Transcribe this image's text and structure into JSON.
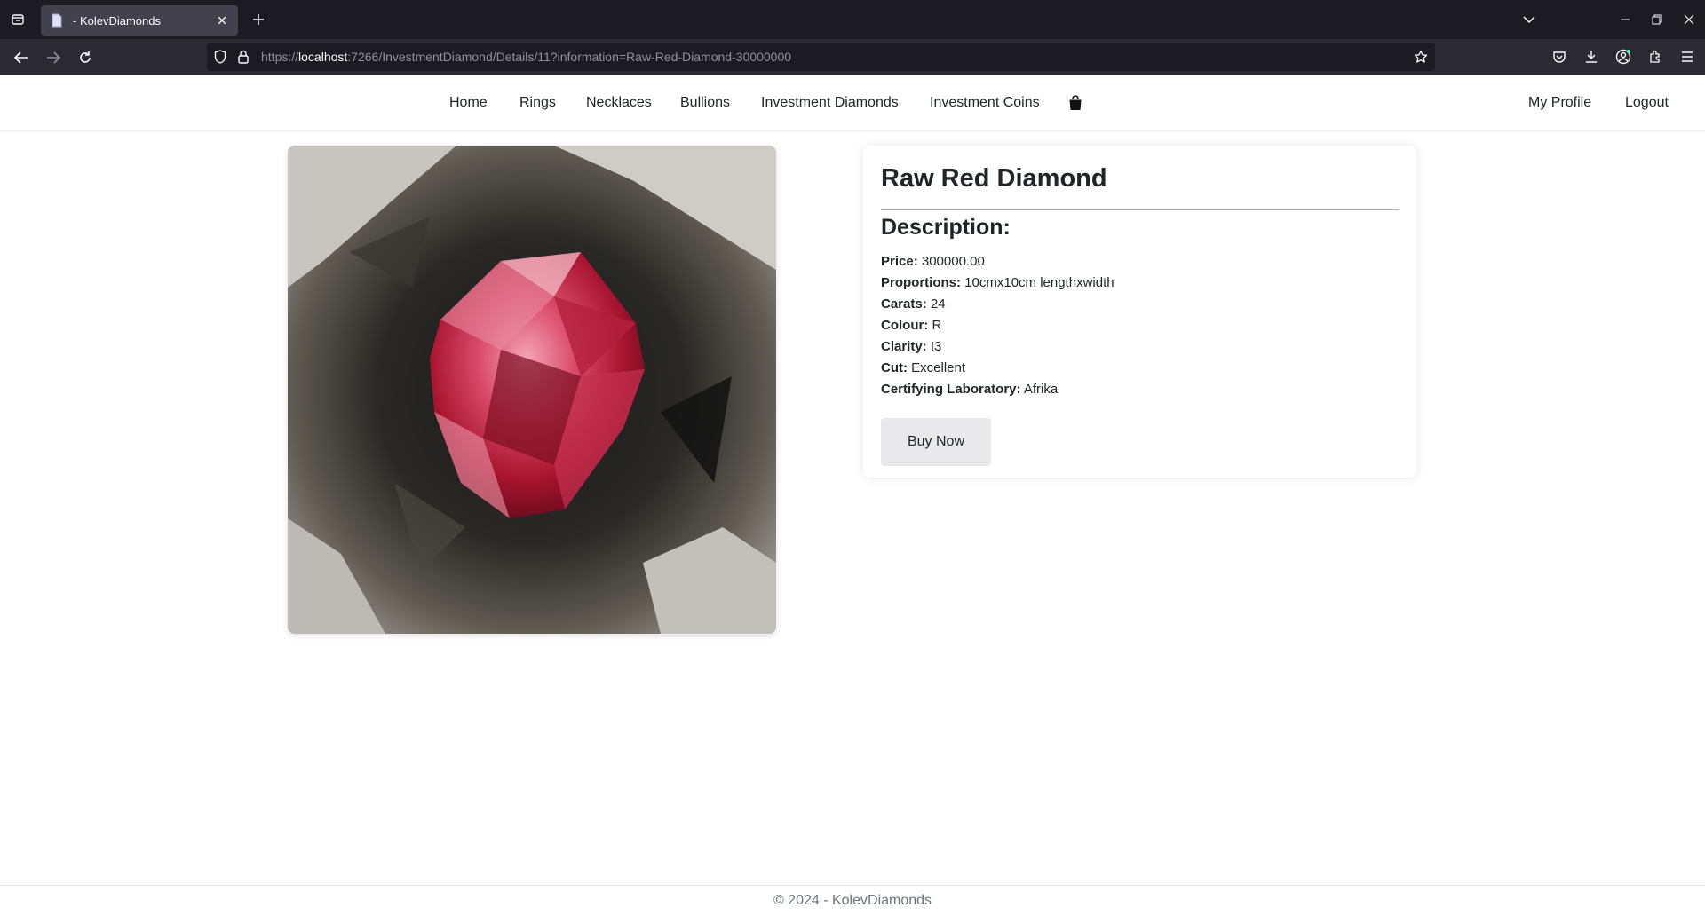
{
  "browser": {
    "tab_title": "- KolevDiamonds",
    "url_prefix": "https://",
    "url_host": "localhost",
    "url_rest": ":7266/InvestmentDiamond/Details/11?information=Raw-Red-Diamond-30000000",
    "icons": [
      "tab-list-icon",
      "page-favicon-icon",
      "close-icon",
      "plus-icon",
      "chevron-down-icon",
      "minimize-icon",
      "restore-icon",
      "close-window-icon",
      "back-arrow-icon",
      "forward-arrow-icon",
      "reload-icon",
      "shield-icon",
      "lock-icon",
      "star-icon",
      "pocket-icon",
      "download-icon",
      "account-icon",
      "extensions-icon",
      "menu-icon"
    ]
  },
  "site": {
    "nav": {
      "home": "Home",
      "rings": "Rings",
      "necklaces": "Necklaces",
      "bullions": "Bullions",
      "investment_diamonds": "Investment Diamonds",
      "investment_coins": "Investment Coins",
      "cart_icon": "shopping-bag-icon"
    },
    "user_nav": {
      "profile": "My Profile",
      "logout": "Logout"
    }
  },
  "product": {
    "title": "Raw Red Diamond",
    "description_heading": "Description:",
    "specs": [
      {
        "label": "Price:",
        "value": "300000.00"
      },
      {
        "label": "Proportions:",
        "value": "10cmx10cm lengthxwidth"
      },
      {
        "label": "Carats:",
        "value": "24"
      },
      {
        "label": "Colour:",
        "value": "R"
      },
      {
        "label": "Clarity:",
        "value": "I3"
      },
      {
        "label": "Cut:",
        "value": "Excellent"
      },
      {
        "label": "Certifying Laboratory:",
        "value": "Afrika"
      }
    ],
    "buy_label": "Buy Now"
  },
  "footer": {
    "copyright": "© 2024 - KolevDiamonds"
  },
  "colors": {
    "tabbar_bg": "#1c1b22",
    "toolbar_bg": "#2b2a33",
    "active_tab_bg": "#42414d",
    "text_dark": "#212529",
    "footer_text": "#6c757d",
    "button_bg": "#e9e9ec",
    "gem_red": "#c8203e"
  }
}
